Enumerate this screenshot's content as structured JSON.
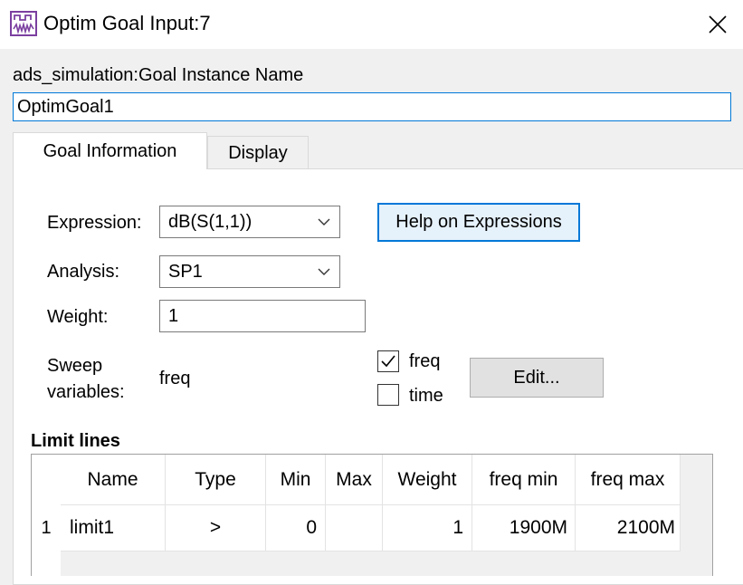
{
  "window": {
    "title": "Optim Goal Input:7"
  },
  "instance": {
    "label": "ads_simulation:Goal Instance Name",
    "value": "OptimGoal1"
  },
  "tabs": [
    {
      "label": "Goal Information",
      "active": true
    },
    {
      "label": "Display",
      "active": false
    }
  ],
  "goal": {
    "expression_label": "Expression:",
    "expression_value": "dB(S(1,1))",
    "analysis_label": "Analysis:",
    "analysis_value": "SP1",
    "weight_label": "Weight:",
    "weight_value": "1",
    "sweep_label_line1": "Sweep",
    "sweep_label_line2": "variables:",
    "sweep_value": "freq",
    "help_button": "Help on Expressions",
    "edit_button": "Edit...",
    "check_freq": {
      "label": "freq",
      "checked": true
    },
    "check_time": {
      "label": "time",
      "checked": false
    }
  },
  "limits": {
    "title": "Limit lines",
    "columns": [
      "Name",
      "Type",
      "Min",
      "Max",
      "Weight",
      "freq min",
      "freq max"
    ],
    "rows": [
      {
        "num": "1",
        "cells": [
          "limit1",
          ">",
          "0",
          "",
          "1",
          "1900M",
          "2100M"
        ]
      }
    ]
  },
  "colors": {
    "accent": "#0078d7",
    "icon": "#7b3fa0"
  },
  "icons": {
    "app": "waveform-icon",
    "close": "close-icon",
    "dropdown": "chevron-down-icon",
    "check": "check-icon"
  }
}
